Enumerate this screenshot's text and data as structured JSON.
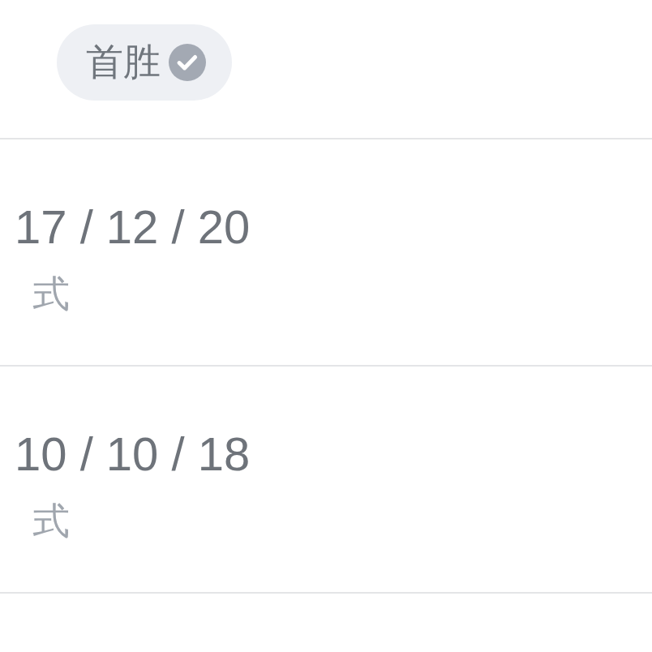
{
  "badge": {
    "label": "首胜",
    "verified": true
  },
  "rows": [
    {
      "score": "17 / 12 / 20",
      "mode": "式"
    },
    {
      "score": "10 / 10 / 18",
      "mode": "式"
    }
  ]
}
